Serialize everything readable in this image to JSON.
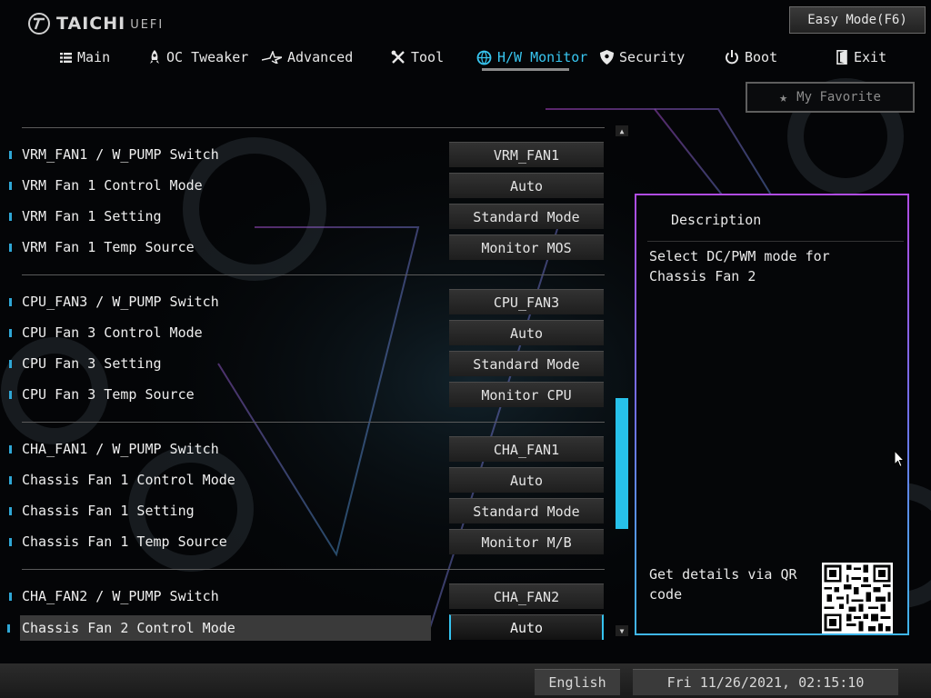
{
  "brand": {
    "name": "TAICHI",
    "sub": "UEFI"
  },
  "header": {
    "easy_mode_label": "Easy Mode(F6)",
    "favorite_label": "My Favorite"
  },
  "nav": [
    {
      "label": "Main",
      "icon": "list-icon",
      "active": false
    },
    {
      "label": "OC Tweaker",
      "icon": "rocket-icon",
      "active": false
    },
    {
      "label": "Advanced",
      "icon": "star-arrow-icon",
      "active": false
    },
    {
      "label": "Tool",
      "icon": "tools-icon",
      "active": false
    },
    {
      "label": "H/W Monitor",
      "icon": "monitor-globe-icon",
      "active": true
    },
    {
      "label": "Security",
      "icon": "shield-icon",
      "active": false
    },
    {
      "label": "Boot",
      "icon": "power-icon",
      "active": false
    },
    {
      "label": "Exit",
      "icon": "exit-door-icon",
      "active": false
    }
  ],
  "settings": [
    {
      "label": "VRM_FAN1 / W_PUMP Switch",
      "value": "VRM_FAN1"
    },
    {
      "label": "VRM Fan 1 Control Mode",
      "value": "Auto"
    },
    {
      "label": "VRM Fan 1 Setting",
      "value": "Standard Mode"
    },
    {
      "label": "VRM Fan 1 Temp Source",
      "value": "Monitor MOS"
    },
    {
      "label": "CPU_FAN3 / W_PUMP Switch",
      "value": "CPU_FAN3"
    },
    {
      "label": "CPU Fan 3 Control Mode",
      "value": "Auto"
    },
    {
      "label": "CPU Fan 3 Setting",
      "value": "Standard Mode"
    },
    {
      "label": "CPU Fan 3 Temp Source",
      "value": "Monitor CPU"
    },
    {
      "label": "CHA_FAN1 / W_PUMP Switch",
      "value": "CHA_FAN1"
    },
    {
      "label": "Chassis Fan 1 Control Mode",
      "value": "Auto"
    },
    {
      "label": "Chassis Fan 1 Setting",
      "value": "Standard Mode"
    },
    {
      "label": "Chassis Fan 1 Temp Source",
      "value": "Monitor M/B"
    },
    {
      "label": "CHA_FAN2 / W_PUMP Switch",
      "value": "CHA_FAN2"
    },
    {
      "label": "Chassis Fan 2 Control Mode",
      "value": "Auto",
      "selected": true
    }
  ],
  "description": {
    "title": "Description",
    "text": "Select DC/PWM mode for Chassis Fan 2",
    "qr_text": "Get details via QR code"
  },
  "footer": {
    "language": "English",
    "datetime": "Fri 11/26/2021, 02:15:10"
  },
  "colors": {
    "accent": "#38c6f0",
    "scroll_thumb": "#27c1ea",
    "panel_border_top": "#b04ce2",
    "panel_border_bottom": "#3fb6ea"
  }
}
